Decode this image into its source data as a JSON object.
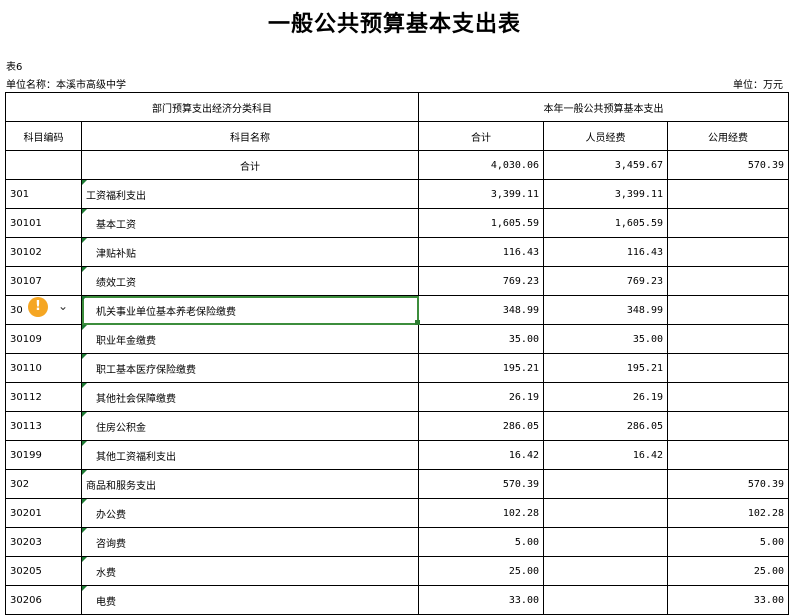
{
  "title": "一般公共预算基本支出表",
  "table_no": "表6",
  "unit_name": "单位名称：本溪市高级中学",
  "unit": "单位：万元",
  "headers": {
    "group_left": "部门预算支出经济分类科目",
    "group_right": "本年一般公共预算基本支出",
    "code": "科目编码",
    "name": "科目名称",
    "total": "合计",
    "personnel": "人员经费",
    "public": "公用经费"
  },
  "rows": [
    {
      "code": "",
      "name": "合计",
      "total": "4,030.06",
      "personnel": "3,459.67",
      "public": "570.39"
    },
    {
      "code": "301",
      "name": "工资福利支出",
      "total": "3,399.11",
      "personnel": "3,399.11",
      "public": ""
    },
    {
      "code": "30101",
      "name": "基本工资",
      "total": "1,605.59",
      "personnel": "1,605.59",
      "public": ""
    },
    {
      "code": "30102",
      "name": "津贴补贴",
      "total": "116.43",
      "personnel": "116.43",
      "public": ""
    },
    {
      "code": "30107",
      "name": "绩效工资",
      "total": "769.23",
      "personnel": "769.23",
      "public": ""
    },
    {
      "code": "30",
      "name": "机关事业单位基本养老保险缴费",
      "total": "348.99",
      "personnel": "348.99",
      "public": ""
    },
    {
      "code": "30109",
      "name": "职业年金缴费",
      "total": "35.00",
      "personnel": "35.00",
      "public": ""
    },
    {
      "code": "30110",
      "name": "职工基本医疗保险缴费",
      "total": "195.21",
      "personnel": "195.21",
      "public": ""
    },
    {
      "code": "30112",
      "name": "其他社会保障缴费",
      "total": "26.19",
      "personnel": "26.19",
      "public": ""
    },
    {
      "code": "30113",
      "name": "住房公积金",
      "total": "286.05",
      "personnel": "286.05",
      "public": ""
    },
    {
      "code": "30199",
      "name": "其他工资福利支出",
      "total": "16.42",
      "personnel": "16.42",
      "public": ""
    },
    {
      "code": "302",
      "name": "商品和服务支出",
      "total": "570.39",
      "personnel": "",
      "public": "570.39"
    },
    {
      "code": "30201",
      "name": "办公费",
      "total": "102.28",
      "personnel": "",
      "public": "102.28"
    },
    {
      "code": "30203",
      "name": "咨询费",
      "total": "5.00",
      "personnel": "",
      "public": "5.00"
    },
    {
      "code": "30205",
      "name": "水费",
      "total": "25.00",
      "personnel": "",
      "public": "25.00"
    },
    {
      "code": "30206",
      "name": "电费",
      "total": "33.00",
      "personnel": "",
      "public": "33.00"
    }
  ],
  "icons": {
    "warning": "warning-icon",
    "dropdown": "chevron-down-icon"
  },
  "icon_glyphs": {
    "warning": "!",
    "dropdown": "⌄"
  },
  "colors": {
    "selection": "#3c8d3c",
    "warning": "#f5a623",
    "marker": "#1e7b34"
  }
}
